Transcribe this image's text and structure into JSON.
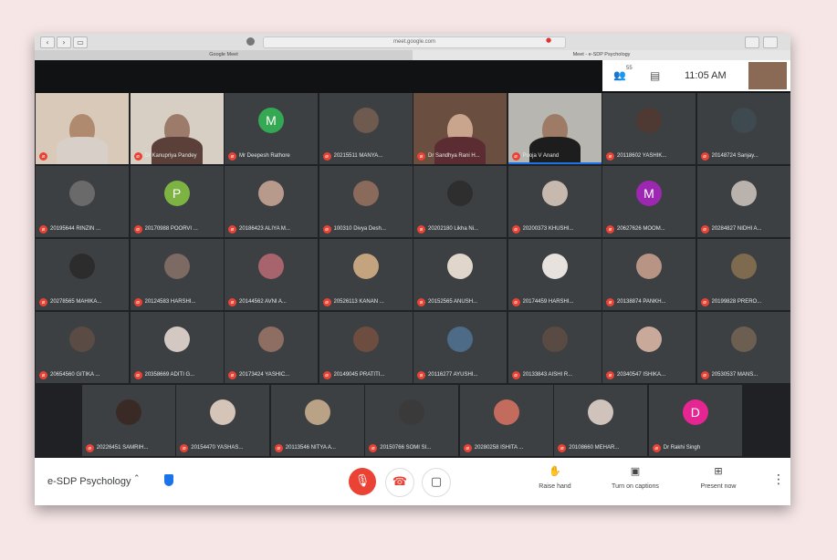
{
  "browser": {
    "url": "meet.google.com",
    "tab_left": "Google Meet",
    "tab_right": "Meet - e-SDP Psychology"
  },
  "header": {
    "people_count": "55",
    "time": "11:05 AM"
  },
  "participants": [
    {
      "name": "",
      "type": "video",
      "c1": "#d9c9b8",
      "c2": "#b08a6f",
      "c3": "#d8d0c8"
    },
    {
      "name": "Dr Kanupriya Pandey",
      "type": "video",
      "c1": "#d8cfc4",
      "c2": "#9c7b6a",
      "c3": "#5a4038"
    },
    {
      "name": "Mr Deepesh Rathore",
      "type": "letter",
      "letter": "M",
      "color": "#34a853"
    },
    {
      "name": "20215511 MANYA...",
      "type": "photo",
      "color": "#6e5a4e"
    },
    {
      "name": "Dr Sandhya Rani H...",
      "type": "video",
      "c1": "#6a4f40",
      "c2": "#c9a58d",
      "c3": "#5b2d32"
    },
    {
      "name": "Pooja V Anand",
      "type": "video",
      "c1": "#b7b6b0",
      "c2": "#9e7b66",
      "c3": "#1d1d1d"
    },
    {
      "name": "20118602 YASHIK...",
      "type": "photo",
      "color": "#4f3a33"
    },
    {
      "name": "20148724 Sanjay...",
      "type": "photo",
      "color": "#3e4a4f"
    },
    {
      "name": "20195644 RINZIN ...",
      "type": "photo",
      "color": "#6a6a6a"
    },
    {
      "name": "20170988 POORVI ...",
      "type": "letter",
      "letter": "P",
      "color": "#7cb342"
    },
    {
      "name": "20186423 ALIYA M...",
      "type": "photo",
      "color": "#b79a8c"
    },
    {
      "name": "100310 Divya Desh...",
      "type": "photo",
      "color": "#8a6a5a"
    },
    {
      "name": "20202180 Likha Ni...",
      "type": "photo",
      "color": "#2e2e2e"
    },
    {
      "name": "20200373 KHUSHI...",
      "type": "photo",
      "color": "#c7b9ae"
    },
    {
      "name": "20627626 MOOM...",
      "type": "letter",
      "letter": "M",
      "color": "#9c27b0"
    },
    {
      "name": "20284827 NIDHI A...",
      "type": "photo",
      "color": "#b9b2ad"
    },
    {
      "name": "20278565 MAHIKA...",
      "type": "photo",
      "color": "#2c2c2c"
    },
    {
      "name": "20124583 HARSHI...",
      "type": "photo",
      "color": "#7d6a62"
    },
    {
      "name": "20144562 AVNI A...",
      "type": "photo",
      "color": "#a8646d"
    },
    {
      "name": "20526113 KANAN ...",
      "type": "photo",
      "color": "#c4a37f"
    },
    {
      "name": "20152565 ANUSH...",
      "type": "photo",
      "color": "#e0d6cc"
    },
    {
      "name": "20174459 HARSHI...",
      "type": "photo",
      "color": "#e7e2de"
    },
    {
      "name": "20138874 PANKH...",
      "type": "photo",
      "color": "#b79484"
    },
    {
      "name": "20199828 PRERO...",
      "type": "photo",
      "color": "#7e6a4f"
    },
    {
      "name": "20654560 GITIKA ...",
      "type": "photo",
      "color": "#5b4b45"
    },
    {
      "name": "20358669 ADITI G...",
      "type": "photo",
      "color": "#d4c8c2"
    },
    {
      "name": "20173424 YASHIC...",
      "type": "photo",
      "color": "#8e6e62"
    },
    {
      "name": "20149045 PRATITI...",
      "type": "photo",
      "color": "#6d4d40"
    },
    {
      "name": "20116277 AYUSHI...",
      "type": "photo",
      "color": "#4d6a86"
    },
    {
      "name": "20133843 AISHI R...",
      "type": "photo",
      "color": "#5a4a44"
    },
    {
      "name": "20340547 ISHIKA...",
      "type": "photo",
      "color": "#c9aa9a"
    },
    {
      "name": "20530537 MANS...",
      "type": "photo",
      "color": "#6c5f52"
    },
    {
      "name": "20226451 SAMRIH...",
      "type": "photo",
      "color": "#3a2a25"
    },
    {
      "name": "20154470 YASHAS...",
      "type": "photo",
      "color": "#d5c4b8"
    },
    {
      "name": "20113546 NITYA A...",
      "type": "photo",
      "color": "#b9a286"
    },
    {
      "name": "20150766 SOMI SI...",
      "type": "photo",
      "color": "#3a3a3a"
    },
    {
      "name": "20280258 ISHITA ...",
      "type": "photo",
      "color": "#c36c5e"
    },
    {
      "name": "20108660 MEHAR...",
      "type": "photo",
      "color": "#cfc3bb"
    },
    {
      "name": "Dr Rakhi Singh",
      "type": "letter",
      "letter": "D",
      "color": "#e52592"
    }
  ],
  "bottom": {
    "meeting_name": "e-SDP Psychology",
    "raise_hand": "Raise hand",
    "captions": "Turn on captions",
    "present": "Present now"
  },
  "colors": {
    "end_call": "#ea4335",
    "mic_off": "#ea4335",
    "active_speaker": "#1a73e8"
  }
}
